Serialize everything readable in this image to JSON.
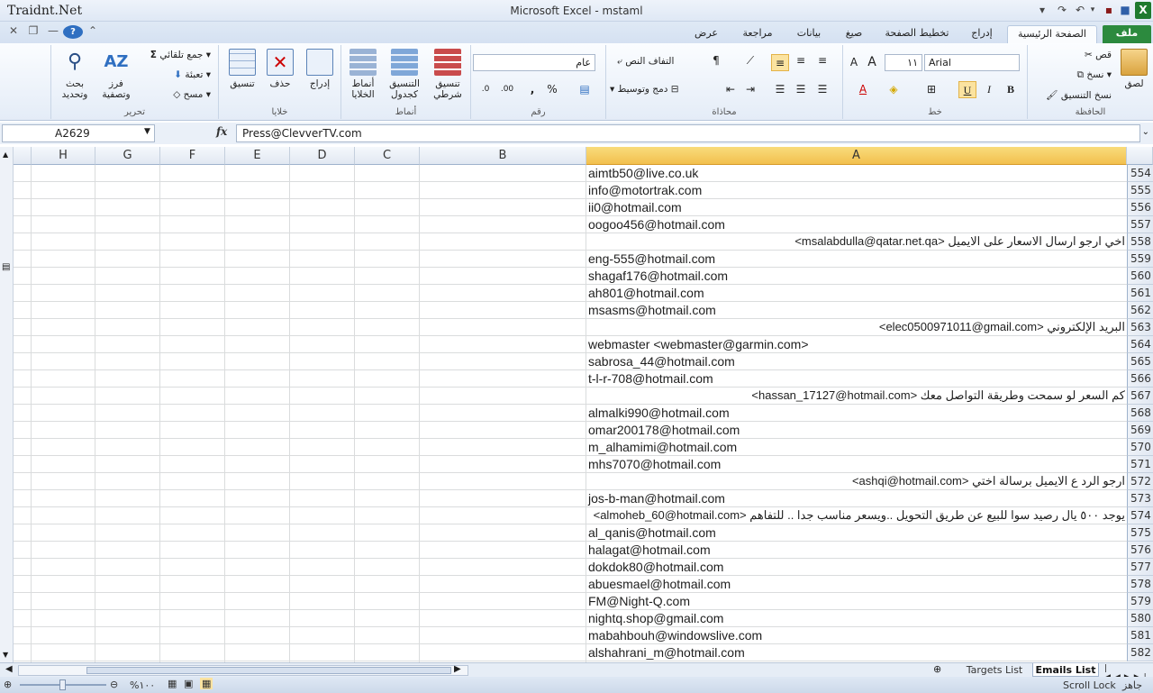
{
  "window": {
    "title": "Microsoft Excel  -  mstaml",
    "watermark": "Traidnt.Net"
  },
  "tabs": {
    "file": "ملف",
    "home": "الصفحة الرئيسية",
    "insert": "إدراج",
    "page_layout": "تخطيط الصفحة",
    "formulas": "صيغ",
    "data": "بيانات",
    "review": "مراجعة",
    "view": "عرض"
  },
  "ribbon": {
    "clipboard": {
      "label": "الحافظة",
      "paste": "لصق",
      "cut": "قص",
      "copy": "نسخ",
      "format_painter": "نسخ التنسيق"
    },
    "font": {
      "label": "خط",
      "font_name": "Arial",
      "font_size": "١١",
      "bold": "B",
      "italic": "I",
      "underline": "U"
    },
    "alignment": {
      "label": "محاذاة",
      "wrap_text": "التفاف النص",
      "merge_center": "دمج وتوسيط"
    },
    "number": {
      "label": "رقم",
      "format": "عام",
      "percent": "%",
      "comma": ","
    },
    "styles": {
      "label": "أنماط",
      "conditional": "تنسيق شرطي",
      "as_table": "التنسيق كجدول",
      "cell_styles": "أنماط الخلايا"
    },
    "cells": {
      "label": "خلايا",
      "insert": "إدراج",
      "delete": "حذف",
      "format": "تنسيق"
    },
    "editing": {
      "label": "تحرير",
      "autosum": "جمع تلقائي",
      "fill": "تعبئة",
      "clear": "مسح",
      "sort_filter_1": "فرز",
      "sort_filter_2": "وتصفية",
      "find_1": "بحث",
      "find_2": "وتحديد"
    }
  },
  "formula_bar": {
    "name_box": "A2629",
    "fx": "fx",
    "content": "Press@ClevverTV.com"
  },
  "columns": [
    "H",
    "G",
    "F",
    "E",
    "D",
    "C",
    "B",
    "A"
  ],
  "rows": [
    {
      "num": "554",
      "value": "aimtb50@live.co.uk",
      "rtl": false
    },
    {
      "num": "555",
      "value": "info@motortrak.com",
      "rtl": false
    },
    {
      "num": "556",
      "value": "ii0@hotmail.com",
      "rtl": false
    },
    {
      "num": "557",
      "value": "oogoo456@hotmail.com",
      "rtl": false
    },
    {
      "num": "558",
      "value": "اخي ارجو ارسال الاسعار على الايميل <msalabdulla@qatar.net.qa>",
      "rtl": true
    },
    {
      "num": "559",
      "value": "eng-555@hotmail.com",
      "rtl": false
    },
    {
      "num": "560",
      "value": "shagaf176@hotmail.com",
      "rtl": false
    },
    {
      "num": "561",
      "value": "ah801@hotmail.com",
      "rtl": false
    },
    {
      "num": "562",
      "value": "msasms@hotmail.com",
      "rtl": false
    },
    {
      "num": "563",
      "value": "البريد الإلكتروني <elec0500971011@gmail.com>",
      "rtl": true
    },
    {
      "num": "564",
      "value": "webmaster <webmaster@garmin.com>",
      "rtl": false
    },
    {
      "num": "565",
      "value": "sabrosa_44@hotmail.com",
      "rtl": false
    },
    {
      "num": "566",
      "value": "t-l-r-708@hotmail.com",
      "rtl": false
    },
    {
      "num": "567",
      "value": "كم السعر لو سمحت وطريقة التواصل معك <hassan_17127@hotmail.com>",
      "rtl": true
    },
    {
      "num": "568",
      "value": "almalki990@hotmail.com",
      "rtl": false
    },
    {
      "num": "569",
      "value": "omar200178@hotmail.com",
      "rtl": false
    },
    {
      "num": "570",
      "value": "m_alhamimi@hotmail.com",
      "rtl": false
    },
    {
      "num": "571",
      "value": "mhs7070@hotmail.com",
      "rtl": false
    },
    {
      "num": "572",
      "value": "ارجو الرد ع الايميل برسالة اختي <ashqi@hotmail.com>",
      "rtl": true
    },
    {
      "num": "573",
      "value": "jos-b-man@hotmail.com",
      "rtl": false
    },
    {
      "num": "574",
      "value": "يوجد ٥٠٠ يال رصيد سوا للبيع  عن طريق التحويل ..ويسعر مناسب جدا .. للتفاهم <almoheb_60@hotmail.com>",
      "rtl": true
    },
    {
      "num": "575",
      "value": "al_qanis@hotmail.com",
      "rtl": false
    },
    {
      "num": "576",
      "value": "halagat@hotmail.com",
      "rtl": false
    },
    {
      "num": "577",
      "value": "dokdok80@hotmail.com",
      "rtl": false
    },
    {
      "num": "578",
      "value": "abuesmael@hotmail.com",
      "rtl": false
    },
    {
      "num": "579",
      "value": "FM@Night-Q.com",
      "rtl": false
    },
    {
      "num": "580",
      "value": "nightq.shop@gmail.com",
      "rtl": false
    },
    {
      "num": "581",
      "value": "mabahbouh@windowslive.com",
      "rtl": false
    },
    {
      "num": "582",
      "value": "alshahrani_m@hotmail.com",
      "rtl": false
    }
  ],
  "sheets": {
    "targets": "Targets List",
    "emails": "Emails List"
  },
  "status": {
    "ready": "جاهز",
    "scroll_lock": "Scroll Lock",
    "zoom": "%١٠٠"
  }
}
